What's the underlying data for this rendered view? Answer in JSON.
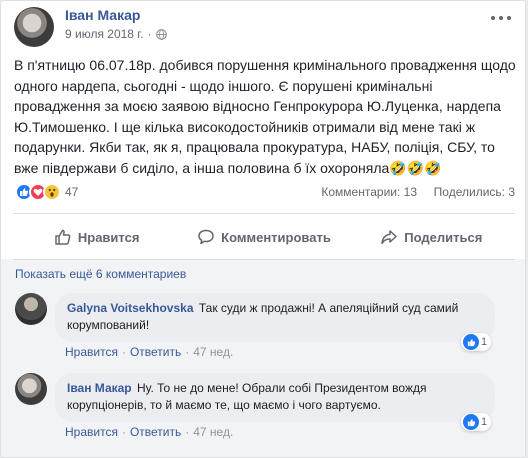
{
  "post": {
    "author": "Іван Макар",
    "date": "9 июля 2018 г.",
    "date_sep": "·",
    "text": "В п'ятницю 06.07.18р. добився порушення кримінального провадження щодо одного нардепа, сьогодні - щодо іншого. Є порушені кримінальні провадження за моєю заявою відносно Генпрокурора Ю.Луценка, нардепа Ю.Тимошенко. І ще кілька високодостойників отримали від мене такі ж подарунки. Якби так, як я, працювала прокуратура, НАБУ, поліція, СБУ, то вже півдержави б сиділо, а інша половина б їх охороняла",
    "text_emoji": "🤣🤣🤣"
  },
  "stats": {
    "reaction_count": "47",
    "comments": "Комментарии: 13",
    "shares": "Поделились: 3"
  },
  "actions": {
    "like": "Нравится",
    "comment": "Комментировать",
    "share": "Поделиться"
  },
  "comments": {
    "more": "Показать ещё 6 комментариев",
    "items": [
      {
        "name": "Galyna Voitsekhovska",
        "text": "Так суди ж продажні! А апеляційний суд самий корумпований!",
        "like": "Нравится",
        "reply": "Ответить",
        "time": "47 нед.",
        "reactions": "1"
      },
      {
        "name": "Іван Макар",
        "text": "Ну. То не до мене! Обрали собі Президентом вождя корупціонерів, то й маємо те, що маємо і чого вартуємо.",
        "like": "Нравится",
        "reply": "Ответить",
        "time": "47 нед.",
        "reactions": "1"
      }
    ]
  },
  "icons": {
    "privacy": "globe-icon",
    "reactions": [
      "like-reaction-icon",
      "love-reaction-icon",
      "wow-reaction-icon"
    ]
  },
  "colors": {
    "link": "#385898",
    "like_blue": "#2078f4",
    "love_red": "#f33e58",
    "wow_yellow": "#f7c33a"
  }
}
